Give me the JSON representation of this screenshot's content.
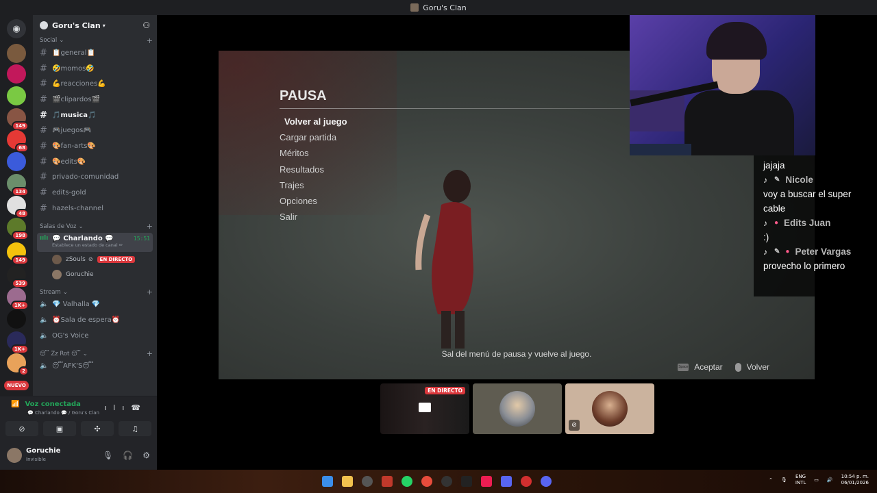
{
  "window": {
    "title": "Goru's Clan"
  },
  "rail": {
    "badges": [
      "149",
      "68",
      "134",
      "48",
      "198",
      "149",
      "539",
      "1K+",
      "1K+",
      "2"
    ],
    "new_label": "NUEVO"
  },
  "guild": {
    "name": "Goru's Clan"
  },
  "categories": {
    "social": "Social",
    "voice": "Salas de Voz",
    "stream": "Stream",
    "zzrot": "😴 Zz Rot 😴"
  },
  "text_channels": [
    {
      "name": "📋general📋"
    },
    {
      "name": "🤣momos🤣"
    },
    {
      "name": "💪reacciones💪"
    },
    {
      "name": "🎬clipardos🎬"
    },
    {
      "name": "🎵musica🎵"
    },
    {
      "name": "🎮juegos🎮"
    },
    {
      "name": "🎨fan-arts🎨"
    },
    {
      "name": "🎨edits🎨"
    },
    {
      "name": "privado-comunidad"
    },
    {
      "name": "edits-gold"
    },
    {
      "name": "hazels-channel"
    }
  ],
  "voice_channel": {
    "name": "💬 Charlando 💬",
    "time": "15:51",
    "status": "Establece un estado de canal ✏",
    "users": [
      {
        "name": "zSouls",
        "live": "EN DIRECTO"
      },
      {
        "name": "Goruchie"
      }
    ]
  },
  "stream_channels": [
    {
      "name": "💎 Valhalla 💎"
    },
    {
      "name": "⏰Sala de espera⏰"
    },
    {
      "name": "OG's Voice"
    }
  ],
  "zz_channels": [
    {
      "name": "😴AFK'S😴"
    }
  ],
  "voice_panel": {
    "status": "Voz conectada",
    "location": "💬 Charlando 💬 / Goru's Clan"
  },
  "user_panel": {
    "username": "Goruchie",
    "status": "Invisible"
  },
  "game": {
    "title": "PAUSA",
    "menu": [
      "Volver al juego",
      "Cargar partida",
      "Méritos",
      "Resultados",
      "Trajes",
      "Opciones",
      "Salir"
    ],
    "hint": "Sal del menú de pausa y vuelve al juego.",
    "accept": "Aceptar",
    "back": "Volver",
    "space_key": "Space"
  },
  "chat": {
    "top_msg": "jajaja",
    "messages": [
      {
        "author": "Nicole",
        "text": "voy a buscar el super cable"
      },
      {
        "author": "Edits Juan",
        "text": ":)"
      },
      {
        "author": "Peter Vargas",
        "text": "provecho lo primero"
      }
    ]
  },
  "tiles": {
    "live_label": "EN DIRECTO"
  },
  "taskbar": {
    "lang1": "ENG",
    "lang2": "INTL",
    "time": "10:54 p. m.",
    "date": "06/01/2026"
  }
}
